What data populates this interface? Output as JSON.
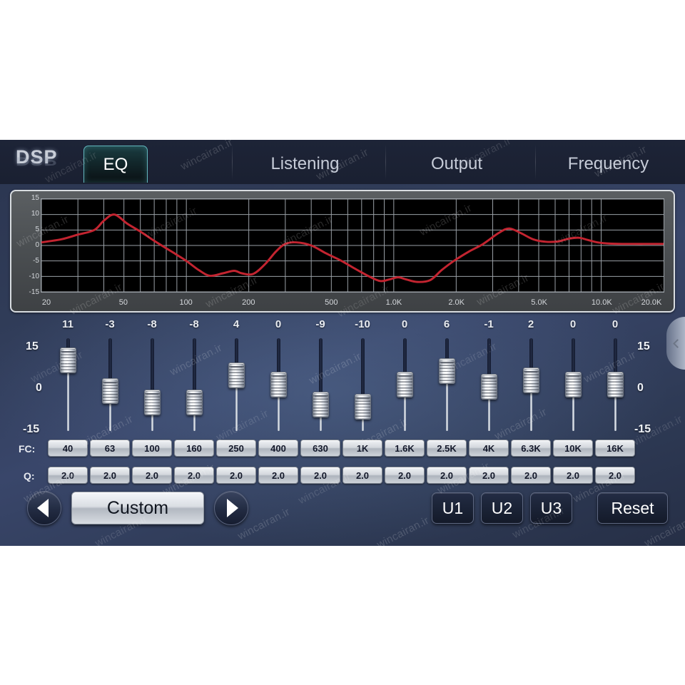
{
  "app": {
    "logo": "DSP"
  },
  "tabs": [
    {
      "label": "EQ",
      "active": true
    },
    {
      "label": "Listening",
      "active": false
    },
    {
      "label": "Output",
      "active": false
    },
    {
      "label": "Frequency",
      "active": false
    }
  ],
  "graph": {
    "y_ticks": [
      "15",
      "10",
      "5",
      "0",
      "-5",
      "-10",
      "-15"
    ],
    "x_ticks": [
      "20",
      "50",
      "100",
      "200",
      "500",
      "1.0K",
      "2.0K",
      "5.0K",
      "10.0K",
      "20.0K"
    ],
    "curve_color": "#c32430",
    "grid_color": "#9aa0a6",
    "plot_background": "#000000"
  },
  "chart_data": {
    "type": "line",
    "title": "",
    "xlabel": "",
    "ylabel": "",
    "x_scale": "log",
    "xlim": [
      20,
      20000
    ],
    "ylim": [
      -15,
      15
    ],
    "grid": true,
    "legend": "none",
    "x_tick_values": [
      20,
      50,
      100,
      200,
      500,
      1000,
      2000,
      5000,
      10000,
      20000
    ],
    "x_tick_labels": [
      "20",
      "50",
      "100",
      "200",
      "500",
      "1.0K",
      "2.0K",
      "5.0K",
      "10.0K",
      "20.0K"
    ],
    "y_tick_values": [
      15,
      10,
      5,
      0,
      -5,
      -10,
      -15
    ],
    "series": [
      {
        "name": "EQ response",
        "color": "#c32430",
        "points": [
          [
            20,
            1
          ],
          [
            25,
            2
          ],
          [
            30,
            3.5
          ],
          [
            36,
            5
          ],
          [
            40,
            8
          ],
          [
            45,
            10
          ],
          [
            52,
            7
          ],
          [
            60,
            4.5
          ],
          [
            70,
            1.5
          ],
          [
            85,
            -2
          ],
          [
            100,
            -5
          ],
          [
            115,
            -8
          ],
          [
            130,
            -9.8
          ],
          [
            150,
            -9
          ],
          [
            170,
            -8.2
          ],
          [
            185,
            -9
          ],
          [
            210,
            -9.2
          ],
          [
            240,
            -6
          ],
          [
            270,
            -2
          ],
          [
            300,
            0.5
          ],
          [
            340,
            1
          ],
          [
            400,
            0
          ],
          [
            470,
            -2.5
          ],
          [
            560,
            -5
          ],
          [
            650,
            -7.5
          ],
          [
            760,
            -10
          ],
          [
            860,
            -11.5
          ],
          [
            950,
            -11
          ],
          [
            1050,
            -10.3
          ],
          [
            1150,
            -11
          ],
          [
            1300,
            -11.8
          ],
          [
            1500,
            -11.2
          ],
          [
            1700,
            -8
          ],
          [
            1950,
            -5
          ],
          [
            2300,
            -2
          ],
          [
            2700,
            0.5
          ],
          [
            3200,
            4
          ],
          [
            3600,
            5.5
          ],
          [
            4100,
            4
          ],
          [
            4700,
            2
          ],
          [
            5400,
            1.2
          ],
          [
            6200,
            1.3
          ],
          [
            7000,
            2.2
          ],
          [
            7800,
            2.5
          ],
          [
            8600,
            1.8
          ],
          [
            9600,
            1.0
          ],
          [
            11000,
            0.6
          ],
          [
            13000,
            0.5
          ],
          [
            16000,
            0.5
          ],
          [
            20000,
            0.5
          ]
        ]
      }
    ]
  },
  "eq_bands": [
    {
      "value": "11",
      "fc": "40",
      "q": "2.0",
      "gain": 11
    },
    {
      "value": "-3",
      "fc": "63",
      "q": "2.0",
      "gain": -3
    },
    {
      "value": "-8",
      "fc": "100",
      "q": "2.0",
      "gain": -8
    },
    {
      "value": "-8",
      "fc": "160",
      "q": "2.0",
      "gain": -8
    },
    {
      "value": "4",
      "fc": "250",
      "q": "2.0",
      "gain": 4
    },
    {
      "value": "0",
      "fc": "400",
      "q": "2.0",
      "gain": 0
    },
    {
      "value": "-9",
      "fc": "630",
      "q": "2.0",
      "gain": -9
    },
    {
      "value": "-10",
      "fc": "1K",
      "q": "2.0",
      "gain": -10
    },
    {
      "value": "0",
      "fc": "1.6K",
      "q": "2.0",
      "gain": 0
    },
    {
      "value": "6",
      "fc": "2.5K",
      "q": "2.0",
      "gain": 6
    },
    {
      "value": "-1",
      "fc": "4K",
      "q": "2.0",
      "gain": -1
    },
    {
      "value": "2",
      "fc": "6.3K",
      "q": "2.0",
      "gain": 2
    },
    {
      "value": "0",
      "fc": "10K",
      "q": "2.0",
      "gain": 0
    },
    {
      "value": "0",
      "fc": "16K",
      "q": "2.0",
      "gain": 0
    }
  ],
  "slider_scale": {
    "top": "15",
    "mid": "0",
    "bottom": "-15",
    "range": [
      -15,
      15
    ]
  },
  "row_labels": {
    "fc": "FC:",
    "q": "Q:"
  },
  "bottom": {
    "prev_label": "◀",
    "preset_name": "Custom",
    "next_label": "▶",
    "user_presets": [
      "U1",
      "U2",
      "U3"
    ],
    "reset_label": "Reset"
  },
  "side_tab": {
    "icon": "chevron-left-icon"
  },
  "watermarks": [
    "wincairan.ir",
    "wincairan.ir",
    "wincairan.ir",
    "wincairan.ir",
    "wincairan.ir",
    "wincairan.ir",
    "wincairan.ir",
    "wincairan.ir",
    "wincairan.ir",
    "wincairan.ir",
    "wincairan.ir",
    "wincairan.ir",
    "wincairan.ir",
    "wincairan.ir",
    "wincairan.ir",
    "wincairan.ir",
    "wincairan.ir",
    "wincairan.ir"
  ]
}
